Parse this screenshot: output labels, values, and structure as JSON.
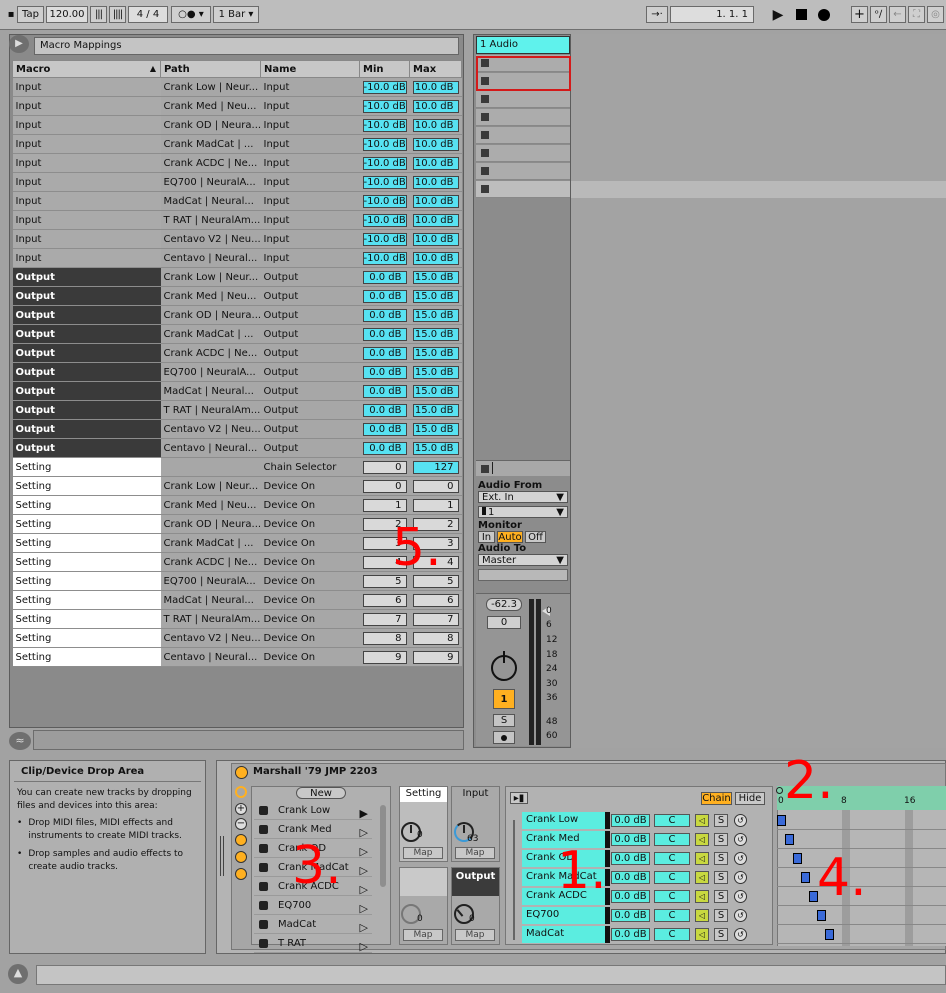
{
  "toolbar": {
    "tap": "Tap",
    "tempo": "120.00",
    "signature": "4 / 4",
    "quantize": "1 Bar",
    "position": "1.   1.   1"
  },
  "macro_panel": {
    "title": "Macro Mappings",
    "headers": [
      "Macro",
      "Path",
      "Name",
      "Min",
      "Max"
    ],
    "rows": [
      [
        "Input",
        "Crank Low | Neur...",
        "Input",
        "-10.0 dB",
        "10.0 dB"
      ],
      [
        "Input",
        "Crank Med | Neu...",
        "Input",
        "-10.0 dB",
        "10.0 dB"
      ],
      [
        "Input",
        "Crank OD | Neura...",
        "Input",
        "-10.0 dB",
        "10.0 dB"
      ],
      [
        "Input",
        "Crank MadCat | ...",
        "Input",
        "-10.0 dB",
        "10.0 dB"
      ],
      [
        "Input",
        "Crank ACDC | Ne...",
        "Input",
        "-10.0 dB",
        "10.0 dB"
      ],
      [
        "Input",
        "EQ700 | NeuralA...",
        "Input",
        "-10.0 dB",
        "10.0 dB"
      ],
      [
        "Input",
        "MadCat | Neural...",
        "Input",
        "-10.0 dB",
        "10.0 dB"
      ],
      [
        "Input",
        "T RAT | NeuralAm...",
        "Input",
        "-10.0 dB",
        "10.0 dB"
      ],
      [
        "Input",
        "Centavo V2 | Neu...",
        "Input",
        "-10.0 dB",
        "10.0 dB"
      ],
      [
        "Input",
        "Centavo | Neural...",
        "Input",
        "-10.0 dB",
        "10.0 dB"
      ],
      [
        "Output",
        "Crank Low | Neur...",
        "Output",
        "0.0 dB",
        "15.0 dB"
      ],
      [
        "Output",
        "Crank Med | Neu...",
        "Output",
        "0.0 dB",
        "15.0 dB"
      ],
      [
        "Output",
        "Crank OD | Neura...",
        "Output",
        "0.0 dB",
        "15.0 dB"
      ],
      [
        "Output",
        "Crank MadCat | ...",
        "Output",
        "0.0 dB",
        "15.0 dB"
      ],
      [
        "Output",
        "Crank ACDC | Ne...",
        "Output",
        "0.0 dB",
        "15.0 dB"
      ],
      [
        "Output",
        "EQ700 | NeuralA...",
        "Output",
        "0.0 dB",
        "15.0 dB"
      ],
      [
        "Output",
        "MadCat | Neural...",
        "Output",
        "0.0 dB",
        "15.0 dB"
      ],
      [
        "Output",
        "T RAT | NeuralAm...",
        "Output",
        "0.0 dB",
        "15.0 dB"
      ],
      [
        "Output",
        "Centavo V2 | Neu...",
        "Output",
        "0.0 dB",
        "15.0 dB"
      ],
      [
        "Output",
        "Centavo | Neural...",
        "Output",
        "0.0 dB",
        "15.0 dB"
      ],
      [
        "Setting",
        "",
        "Chain Selector",
        "0",
        "127"
      ],
      [
        "Setting",
        "Crank Low | Neur...",
        "Device On",
        "0",
        "0"
      ],
      [
        "Setting",
        "Crank Med | Neu...",
        "Device On",
        "1",
        "1"
      ],
      [
        "Setting",
        "Crank OD | Neura...",
        "Device On",
        "2",
        "2"
      ],
      [
        "Setting",
        "Crank MadCat | ...",
        "Device On",
        "3",
        "3"
      ],
      [
        "Setting",
        "Crank ACDC | Ne...",
        "Device On",
        "4",
        "4"
      ],
      [
        "Setting",
        "EQ700 | NeuralA...",
        "Device On",
        "5",
        "5"
      ],
      [
        "Setting",
        "MadCat | Neural...",
        "Device On",
        "6",
        "6"
      ],
      [
        "Setting",
        "T RAT | NeuralAm...",
        "Device On",
        "7",
        "7"
      ],
      [
        "Setting",
        "Centavo V2 | Neu...",
        "Device On",
        "8",
        "8"
      ],
      [
        "Setting",
        "Centavo | Neural...",
        "Device On",
        "9",
        "9"
      ]
    ]
  },
  "track": {
    "name": "1 Audio",
    "audio_from_label": "Audio From",
    "audio_from": "Ext. In",
    "channel": "1",
    "monitor_label": "Monitor",
    "monitor_in": "In",
    "monitor_auto": "Auto",
    "monitor_off": "Off",
    "audio_to_label": "Audio To",
    "audio_to": "Master",
    "volume": "-62.3",
    "pan": "0",
    "track_number": "1",
    "solo": "S",
    "meter_scale": [
      "0",
      "6",
      "12",
      "18",
      "24",
      "30",
      "36",
      "48",
      "60"
    ]
  },
  "info": {
    "title": "Clip/Device Drop Area",
    "text": "You can create new tracks by dropping files and devices into this area:",
    "bullets": [
      "Drop MIDI files, MIDI effects and instruments to create MIDI tracks.",
      "Drop samples and audio effects to create audio tracks."
    ]
  },
  "device": {
    "title": "Marshall '79 JMP 2203",
    "new": "New",
    "chain_list": [
      "Crank Low",
      "Crank Med",
      "Crank OD",
      "Crank MadCat",
      "Crank ACDC",
      "EQ700",
      "MadCat",
      "T RAT"
    ],
    "macros": {
      "setting": "Setting",
      "input": "Input",
      "input_value": "63",
      "output": "Output",
      "setting_value": "0",
      "output_value": "0",
      "map": "Map"
    },
    "chain_btn": "Chain",
    "hide_btn": "Hide",
    "ruler": [
      "0",
      "8",
      "16"
    ],
    "chains": [
      {
        "name": "Crank Low",
        "vol": "0.0 dB",
        "pan": "C"
      },
      {
        "name": "Crank Med",
        "vol": "0.0 dB",
        "pan": "C"
      },
      {
        "name": "Crank OD",
        "vol": "0.0 dB",
        "pan": "C"
      },
      {
        "name": "Crank MadCat",
        "vol": "0.0 dB",
        "pan": "C"
      },
      {
        "name": "Crank ACDC",
        "vol": "0.0 dB",
        "pan": "C"
      },
      {
        "name": "EQ700",
        "vol": "0.0 dB",
        "pan": "C"
      },
      {
        "name": "MadCat",
        "vol": "0.0 dB",
        "pan": "C"
      }
    ],
    "solo": "S"
  },
  "annotations": [
    "1.",
    "2.",
    "3.",
    "4.",
    "5."
  ],
  "colors": {
    "cyan": "#57e2f2",
    "chain": "#5bede0",
    "orange": "#ffb020",
    "red": "#ff0000"
  }
}
